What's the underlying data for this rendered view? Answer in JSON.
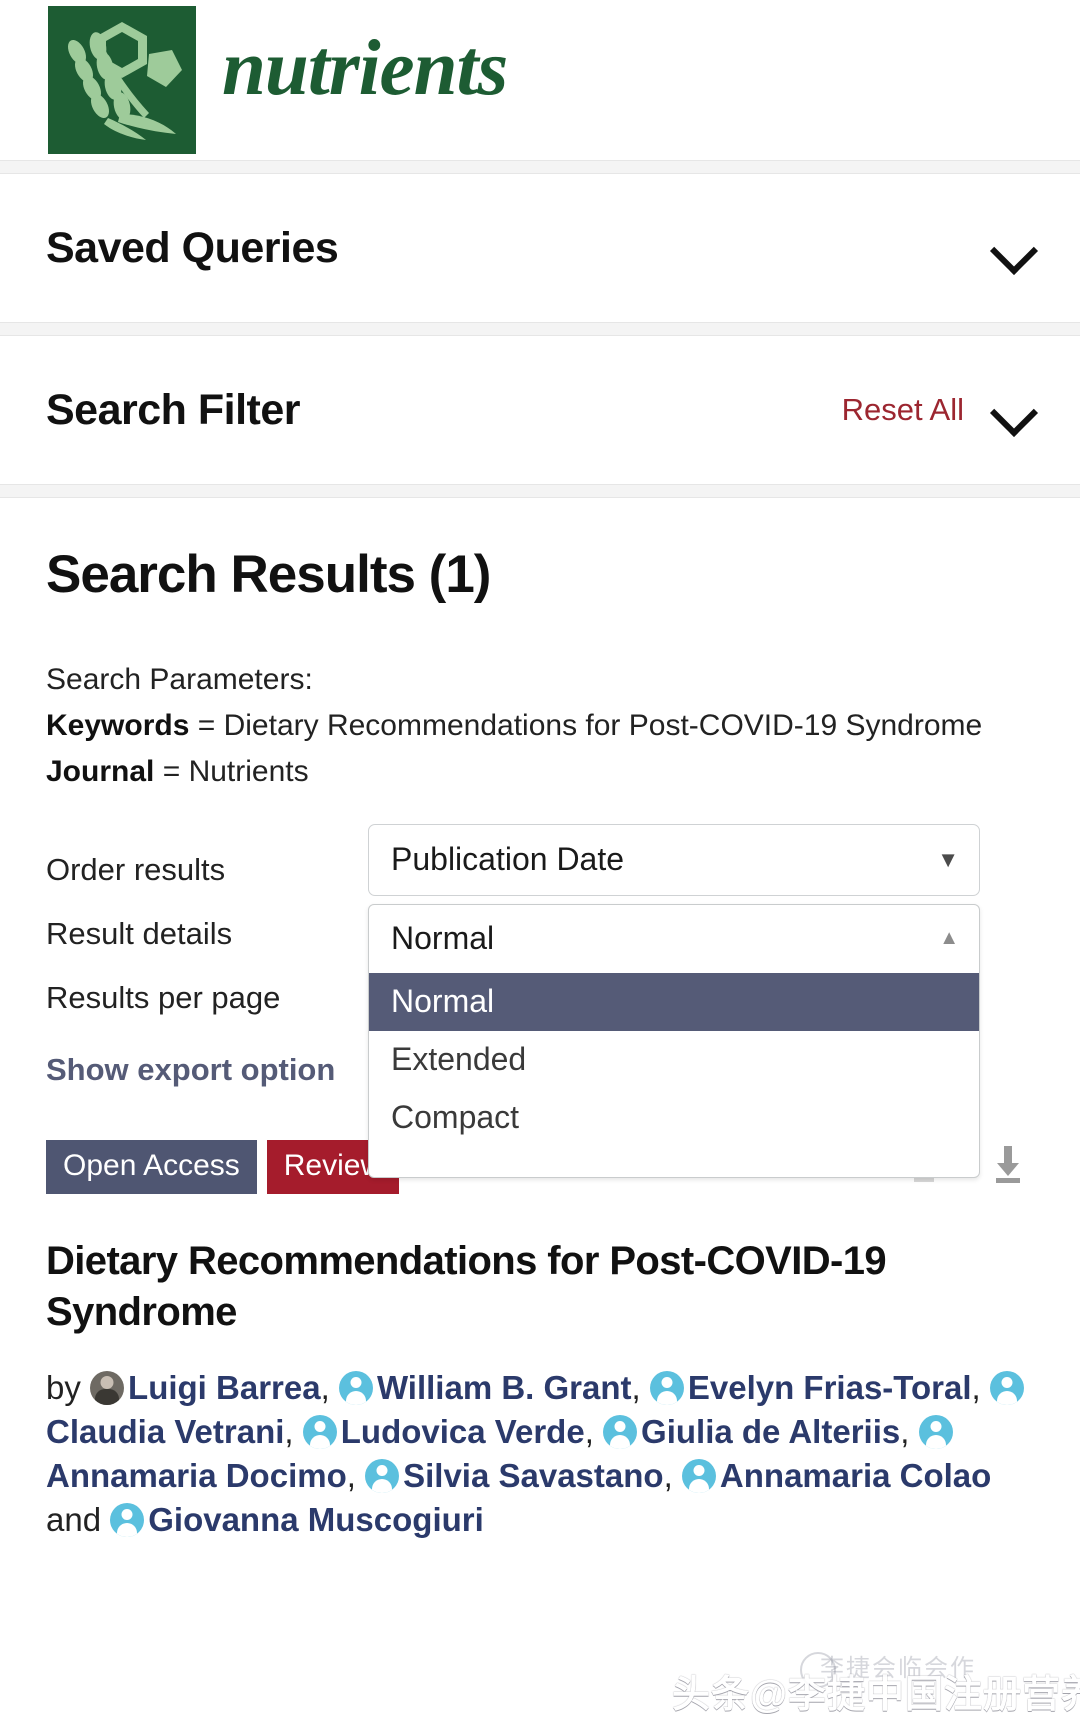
{
  "header": {
    "journal_name": "nutrients",
    "logo_icon": "wheat-molecule-logo"
  },
  "panels": [
    {
      "title": "Saved Queries",
      "chevron_icon": "chevron-down-icon",
      "reset_label": ""
    },
    {
      "title": "Search Filter",
      "chevron_icon": "chevron-down-icon",
      "reset_label": "Reset All"
    }
  ],
  "results": {
    "heading": "Search Results (1)",
    "params_heading": "Search Parameters:",
    "params": [
      {
        "key": "Keywords",
        "eq": " = ",
        "value": "Dietary Recommendations for Post-COVID-19 Syndrome"
      },
      {
        "key": "Journal",
        "eq": " = ",
        "value": "Nutrients"
      }
    ],
    "options": {
      "order_label": "Order results",
      "order_value": "Publication Date",
      "order_caret_icon": "caret-down-icon",
      "details_label": "Result details",
      "details_value": "Normal",
      "details_caret_icon": "caret-up-icon",
      "per_page_label": "Results per page",
      "details_options": [
        "Normal",
        "Extended",
        "Compact"
      ],
      "details_selected": "Normal",
      "export_link": "Show export option"
    }
  },
  "article": {
    "badges": [
      {
        "label": "Open Access",
        "color": "#4f5672"
      },
      {
        "label": "Review",
        "color": "#a51c2c"
      }
    ],
    "icons": [
      {
        "name": "abstract-lines-icon"
      },
      {
        "name": "download-icon"
      }
    ],
    "title": "Dietary Recommendations for Post-COVID-19 Syndrome",
    "by_prefix": "by",
    "and_word": "and",
    "authors": [
      "Luigi Barrea",
      "William B. Grant",
      "Evelyn Frias-Toral",
      "Claudia Vetrani",
      "Ludovica Verde",
      "Giulia de Alteriis",
      "Annamaria Docimo",
      "Silvia Savastano",
      "Annamaria Colao",
      "Giovanna Muscogiuri"
    ]
  },
  "watermark": {
    "main": "头条@李捷中国注册营养师",
    "faint": "李捷会临会作"
  },
  "colors": {
    "brand_green": "#1d5c33",
    "accent_slate": "#555b77",
    "accent_red": "#a51c2c",
    "reset_red": "#9c2630",
    "author_blue": "#2b3a6b",
    "avatar_cyan": "#5bc0de"
  }
}
